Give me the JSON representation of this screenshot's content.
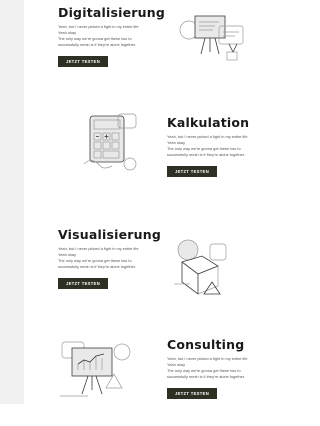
{
  "sections": [
    {
      "title": "Digitalisierung",
      "text": [
        "Yeah, but I never picked a fight in my entire life",
        "Yeah okay",
        "The only way we're gonna get these two to",
        "successfully mesh is if they're alone together."
      ],
      "button": "JETZT TESTEN",
      "icon": "whiteboard-presentation-icon"
    },
    {
      "title": "Kalkulation",
      "text": [
        "Yeah, but I never picked a fight in my entire life",
        "Yeah okay",
        "The only way we're gonna get these two to",
        "successfully mesh is if they're alone together."
      ],
      "button": "JETZT TESTEN",
      "icon": "calculator-icon"
    },
    {
      "title": "Visualisierung",
      "text": [
        "Yeah, but I never picked a fight in my entire life",
        "Yeah okay",
        "The only way we're gonna get these two to",
        "successfully mesh is if they're alone together."
      ],
      "button": "JETZT TESTEN",
      "icon": "3d-cube-shapes-icon"
    },
    {
      "title": "Consulting",
      "text": [
        "Yeah, but I never picked a fight in my entire life",
        "Yeah okay",
        "The only way we're gonna get these two to",
        "successfully mesh is if they're alone together."
      ],
      "button": "JETZT TESTEN",
      "icon": "chart-board-icon"
    }
  ],
  "colors": {
    "button_bg": "#2d3022",
    "button_text": "#ffffff",
    "sidebar_bg": "#f1f1f1"
  }
}
